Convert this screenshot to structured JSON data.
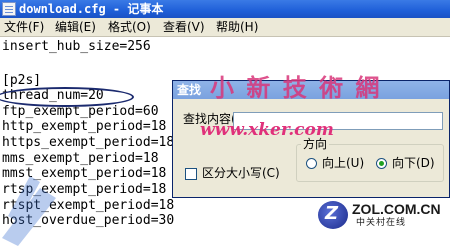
{
  "window": {
    "title": "download.cfg - 记事本"
  },
  "menu": {
    "items": [
      {
        "label": "文件(F)"
      },
      {
        "label": "编辑(E)"
      },
      {
        "label": "格式(O)"
      },
      {
        "label": "查看(V)"
      },
      {
        "label": "帮助(H)"
      }
    ]
  },
  "editor": {
    "lines": [
      "insert_hub_size=256",
      "",
      "[p2s]",
      "thread_num=20",
      "ftp_exempt_period=60",
      "http_exempt_period=18",
      "https_exempt_period=18",
      "mms_exempt_period=18",
      "mmst_exempt_period=18",
      "rtsp_exempt_period=18",
      "rtspt_exempt_period=18",
      "host_overdue_period=30"
    ]
  },
  "find_dialog": {
    "title": "查找",
    "find_label": "查找内容(N):",
    "find_value": "",
    "direction_label": "方向",
    "up_label": "向上(U)",
    "down_label": "向下(D)",
    "direction_selected": "down",
    "match_case_label": "区分大小写(C)",
    "match_case_checked": false
  },
  "watermarks": {
    "site_logo": "小 新 技 術 網",
    "site_url": "www.xker.com",
    "zol_brand": "ZOL.COM.CN",
    "zol_sub": "中关村在线"
  },
  "colors": {
    "titlebar": "#1f5fd8",
    "dialog_titlebar": "#7aa2df",
    "dialog_bg": "#ece9d8",
    "highlight_ring": "#1b2a6e",
    "watermark_pink": "#d9367a"
  }
}
